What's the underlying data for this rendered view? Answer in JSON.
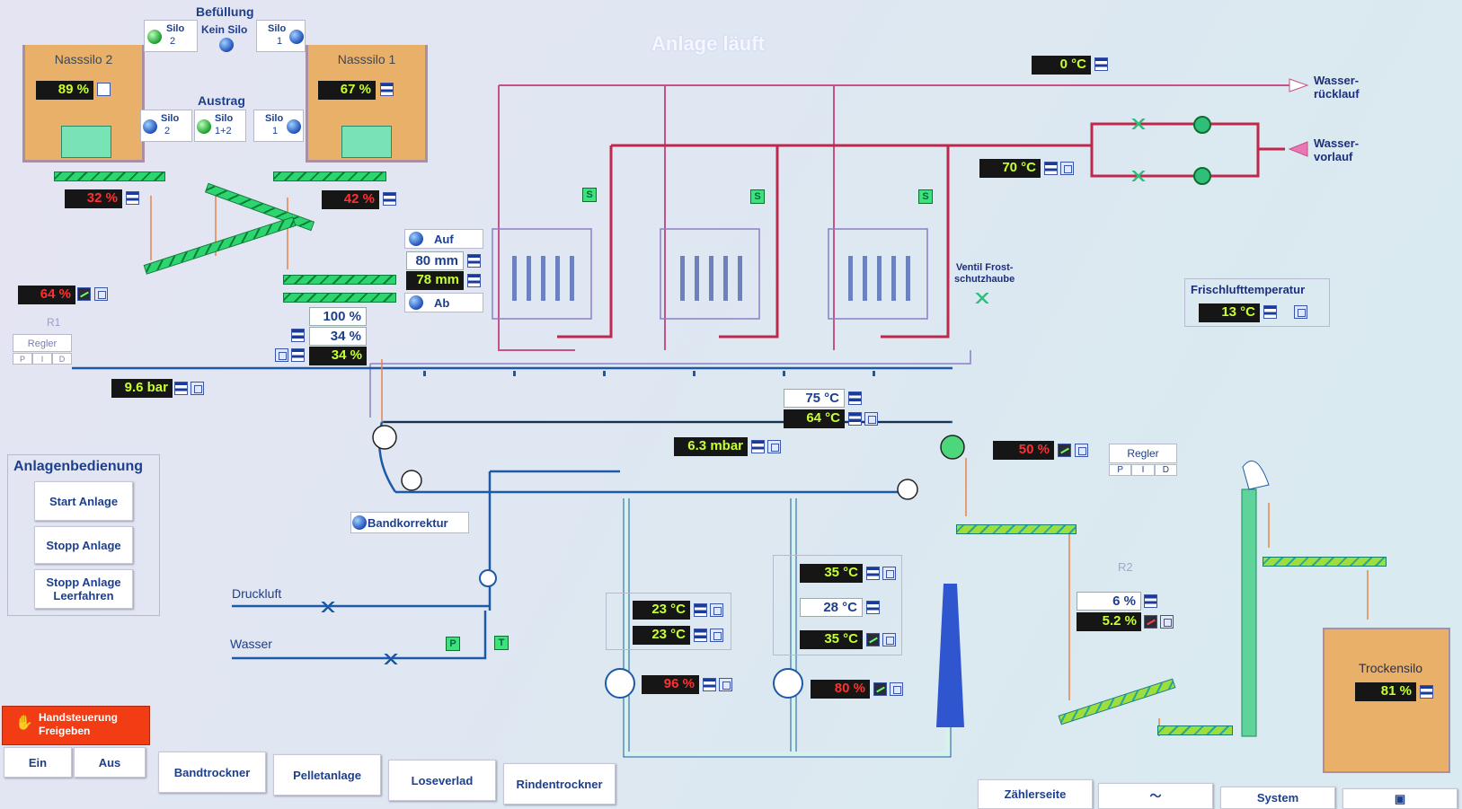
{
  "header": {
    "status": "Anlage läuft"
  },
  "fill": {
    "title": "Befüllung",
    "silo2": {
      "l1": "Silo",
      "l2": "2"
    },
    "none": "Kein Silo",
    "silo1": {
      "l1": "Silo",
      "l2": "1"
    }
  },
  "discharge": {
    "title": "Austrag",
    "silo2": {
      "l1": "Silo",
      "l2": "2"
    },
    "silo12": {
      "l1": "Silo",
      "l2": "1+2"
    },
    "silo1": {
      "l1": "Silo",
      "l2": "1"
    }
  },
  "silo_left": {
    "name": "Nasssilo 2",
    "level": "89 %",
    "outflow": "32 %"
  },
  "silo_right": {
    "name": "Nasssilo 1",
    "level": "67 %",
    "outflow": "42 %"
  },
  "mixer": {
    "value": "64 %",
    "r1": "R1",
    "regler": "Regler",
    "pid": [
      "P",
      "I",
      "D"
    ]
  },
  "pressure": {
    "value": "9.6 bar"
  },
  "layer": {
    "up": "Auf",
    "down": "Ab",
    "set": "80 mm",
    "actual": "78 mm"
  },
  "feed": {
    "v1": "100 %",
    "v2": "34 %",
    "v3": "34 %"
  },
  "water_return": {
    "temp": "0 °C",
    "label": "Wasser-\nrücklauf"
  },
  "water_supply": {
    "temp": "70 °C",
    "label": "Wasser-\nvorlauf"
  },
  "valve_frost": {
    "label": "Ventil Frost-\nschutzhaube"
  },
  "fresh_air": {
    "title": "Frischlufttemperatur",
    "value": "13 °C"
  },
  "dryer_belt": {
    "t_set": "75 °C",
    "t_act": "64 °C",
    "pressure": "6.3 mbar",
    "speed": "50 %"
  },
  "regler2": {
    "label": "Regler",
    "pid": [
      "P",
      "I",
      "D"
    ],
    "r2": "R2",
    "set": "6 %",
    "act": "5.2 %"
  },
  "operation": {
    "title": "Anlagenbedienung",
    "start": "Start Anlage",
    "stop": "Stopp Anlage",
    "stop_empty": "Stopp Anlage\nLeerfahren"
  },
  "band_corr": "Bandkorrektur",
  "lines": {
    "air": "Druckluft",
    "water": "Wasser",
    "p": "P",
    "t": "T"
  },
  "fan_left": {
    "t1": "23 °C",
    "t2": "23 °C",
    "speed": "96 %"
  },
  "fan_right": {
    "t1": "35 °C",
    "t2": "28 °C",
    "t3": "35 °C",
    "speed": "80 %"
  },
  "heater_s": "S",
  "dry_silo": {
    "name": "Trockensilo",
    "level": "81 %"
  },
  "manual": {
    "title": "Handsteuerung\nFreigeben",
    "on": "Ein",
    "off": "Aus"
  },
  "nav": [
    "Bandtrockner",
    "Pelletanlage",
    "Loseverlad",
    "Rindentrockner",
    "Zählerseite",
    "System"
  ]
}
